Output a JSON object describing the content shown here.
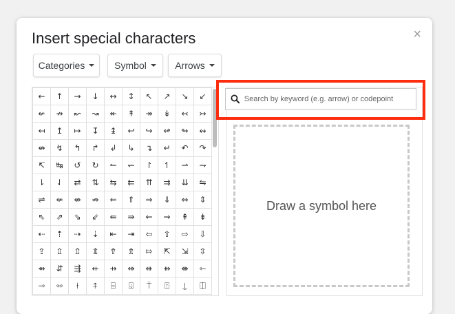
{
  "dialog": {
    "title": "Insert special characters",
    "close_label": "×"
  },
  "filters": {
    "category": "Categories",
    "subcategory": "Symbol",
    "type": "Arrows"
  },
  "search": {
    "placeholder": "Search by keyword (e.g. arrow) or codepoint"
  },
  "draw": {
    "prompt": "Draw a symbol here"
  },
  "characters": [
    [
      "←",
      "↑",
      "→",
      "↓",
      "↔",
      "↕",
      "↖",
      "↗",
      "↘",
      "↙"
    ],
    [
      "↚",
      "↛",
      "↜",
      "↝",
      "↞",
      "↟",
      "↠",
      "↡",
      "↢",
      "↣"
    ],
    [
      "↤",
      "↥",
      "↦",
      "↧",
      "↨",
      "↩",
      "↪",
      "↫",
      "↬",
      "↭"
    ],
    [
      "↮",
      "↯",
      "↰",
      "↱",
      "↲",
      "↳",
      "↴",
      "↵",
      "↶",
      "↷"
    ],
    [
      "↸",
      "↹",
      "↺",
      "↻",
      "↼",
      "↽",
      "↾",
      "↿",
      "⇀",
      "⇁"
    ],
    [
      "⇂",
      "⇃",
      "⇄",
      "⇅",
      "⇆",
      "⇇",
      "⇈",
      "⇉",
      "⇊",
      "⇋"
    ],
    [
      "⇌",
      "⇍",
      "⇎",
      "⇏",
      "⇐",
      "⇑",
      "⇒",
      "⇓",
      "⇔",
      "⇕"
    ],
    [
      "⇖",
      "⇗",
      "⇘",
      "⇙",
      "⇚",
      "⇛",
      "⇜",
      "⇝",
      "⇞",
      "⇟"
    ],
    [
      "⇠",
      "⇡",
      "⇢",
      "⇣",
      "⇤",
      "⇥",
      "⇦",
      "⇧",
      "⇨",
      "⇩"
    ],
    [
      "⇪",
      "⇫",
      "⇬",
      "⇭",
      "⇮",
      "⇯",
      "⇰",
      "⇱",
      "⇲",
      "⇳"
    ],
    [
      "⇴",
      "⇵",
      "⇶",
      "⇷",
      "⇸",
      "⇹",
      "⇺",
      "⇻",
      "⇼",
      "⇽"
    ],
    [
      "⇾",
      "⇿",
      "⍿",
      "⍏",
      "⌸",
      "⌹",
      "⍑",
      "⍐",
      "⍊",
      "⎅"
    ]
  ],
  "colors": {
    "highlight": "#ff2d10",
    "border": "#e0e0e0"
  }
}
